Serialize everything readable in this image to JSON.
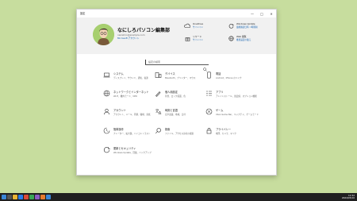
{
  "window": {
    "title": "設定",
    "min": "—",
    "max": "□",
    "close": "✕"
  },
  "header": {
    "pc_name": "なにしろパソコン編集部",
    "email": "nanishiro@example.com",
    "account_link": "Microsoft アカウント",
    "info": [
      {
        "title": "OneDrive",
        "status": "サインイン",
        "icon": "onedrive-icon"
      },
      {
        "title": "Windows Update",
        "status": "最終確認日時: 1時間前",
        "icon": "windows-update-icon"
      },
      {
        "title": "リワード",
        "status": "サインイン",
        "icon": "rewards-icon"
      },
      {
        "title": "Web 閲覧",
        "status": "推奨設定の復元",
        "icon": "web-browsing-icon"
      }
    ]
  },
  "search": {
    "placeholder": "設定の検索"
  },
  "categories": [
    {
      "title": "システム",
      "desc": "ディスプレイ、サウンド、通知、電源",
      "icon": "laptop-icon"
    },
    {
      "title": "デバイス",
      "desc": "Bluetooth、プリンター、マウス",
      "icon": "devices-icon"
    },
    {
      "title": "電話",
      "desc": "Android、iPhone のリンク",
      "icon": "phone-icon"
    },
    {
      "title": "ネットワークとインターネット",
      "desc": "Wi-Fi、機内モード、VPN",
      "icon": "globe-icon"
    },
    {
      "title": "個人用設定",
      "desc": "背景、ロック画面、色",
      "icon": "personalize-icon"
    },
    {
      "title": "アプリ",
      "desc": "アンインストール、既定値、オプション機能",
      "icon": "apps-icon"
    },
    {
      "title": "アカウント",
      "desc": "アカウント、メール、同期、職場、家族",
      "icon": "account-icon"
    },
    {
      "title": "時刻と言語",
      "desc": "音声認識、地域、日付",
      "icon": "time-language-icon"
    },
    {
      "title": "ゲーム",
      "desc": "Xbox Game Bar、キャプチャ、ゲームモード",
      "icon": "gaming-icon"
    },
    {
      "title": "簡単操作",
      "desc": "ナレーター、拡大鏡、ハイコントラスト",
      "icon": "accessibility-icon"
    },
    {
      "title": "検索",
      "desc": "ファイル、アクセス許可の検索",
      "icon": "search-icon"
    },
    {
      "title": "プライバシー",
      "desc": "場所、カメラ、マイク",
      "icon": "privacy-icon"
    },
    {
      "title": "更新とセキュリティ",
      "desc": "Windows Update、回復、バックアップ",
      "icon": "update-security-icon"
    }
  ],
  "taskbar": {
    "time": "11:52",
    "date": "2024/05/10"
  }
}
